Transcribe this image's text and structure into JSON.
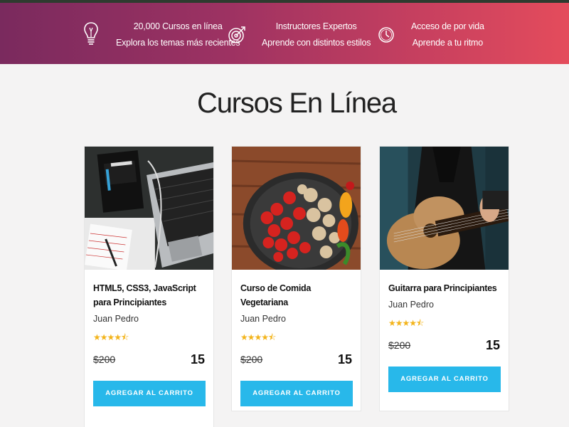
{
  "banner": {
    "features": [
      {
        "icon": "lightbulb-icon",
        "line1": "20,000 Cursos en línea",
        "line2": "Explora los temas más recientes"
      },
      {
        "icon": "target-icon",
        "line1": "Instructores Expertos",
        "line2": "Aprende con distintos estilos"
      },
      {
        "icon": "clock-icon",
        "line1": "Acceso de por vida",
        "line2": "Aprende a tu ritmo"
      }
    ]
  },
  "section": {
    "title": "Cursos En Línea"
  },
  "courses": [
    {
      "title": "HTML5, CSS3, JavaScript para Principiantes",
      "author": "Juan Pedro",
      "rating_stars": 4.5,
      "stars": "★★★★⯪",
      "old_price": "$200",
      "price": "15",
      "button": "AGREGAR AL CARRITO"
    },
    {
      "title": "Curso de Comida Vegetariana",
      "author": "Juan Pedro",
      "rating_stars": 4.5,
      "stars": "★★★★⯪",
      "old_price": "$200",
      "price": "15",
      "button": "AGREGAR AL CARRITO"
    },
    {
      "title": "Guitarra para Principiantes",
      "author": "Juan Pedro",
      "rating_stars": 4.5,
      "stars": "★★★★⯪",
      "old_price": "$200",
      "price": "15",
      "button": "AGREGAR AL CARRITO"
    }
  ],
  "colors": {
    "accent": "#28b8ea",
    "banner_start": "#7a2a5e",
    "banner_end": "#e44c5c",
    "stars": "#f3b41b"
  }
}
